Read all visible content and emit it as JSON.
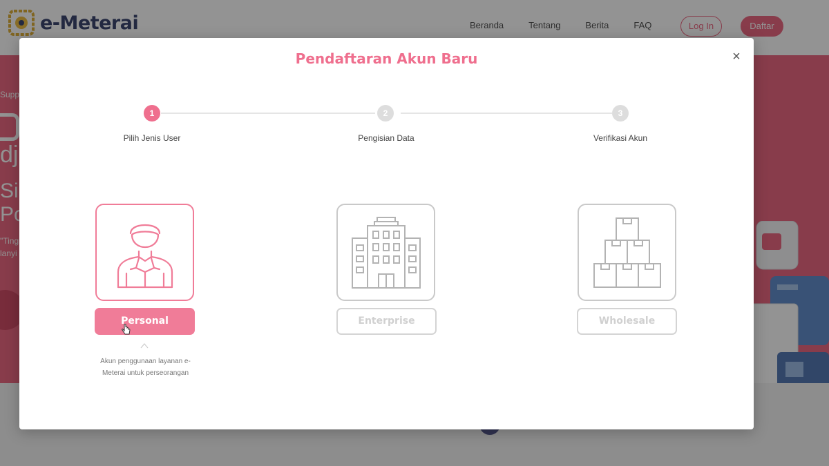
{
  "navbar": {
    "brand": "e-Meterai",
    "links": [
      "Beranda",
      "Tentang",
      "Berita",
      "FAQ"
    ],
    "login_label": "Log In",
    "daftar_label": "Daftar"
  },
  "hero": {
    "small_text": "Supp",
    "line_dj": "dj",
    "line_si": "Si",
    "line_po": "Po",
    "quote_1": "\"Ting",
    "quote_2": "lanyi"
  },
  "modal": {
    "title": "Pendaftaran Akun Baru",
    "close_icon": "×",
    "steps": [
      {
        "number": "1",
        "label": "Pilih Jenis User",
        "state": "active"
      },
      {
        "number": "2",
        "label": "Pengisian Data",
        "state": "inactive"
      },
      {
        "number": "3",
        "label": "Verifikasi Akun",
        "state": "inactive"
      }
    ],
    "user_types": [
      {
        "label": "Personal",
        "icon": "person-icon",
        "selected": true
      },
      {
        "label": "Enterprise",
        "icon": "building-icon",
        "selected": false
      },
      {
        "label": "Wholesale",
        "icon": "boxes-icon",
        "selected": false
      }
    ],
    "description": "Akun penggunaan layanan e-Meterai untuk perseorangan"
  },
  "colors": {
    "accent": "#ef6f8e",
    "hero": "#e8506f",
    "brand_text": "#1f2a5a",
    "inactive": "#c9c9c9"
  }
}
